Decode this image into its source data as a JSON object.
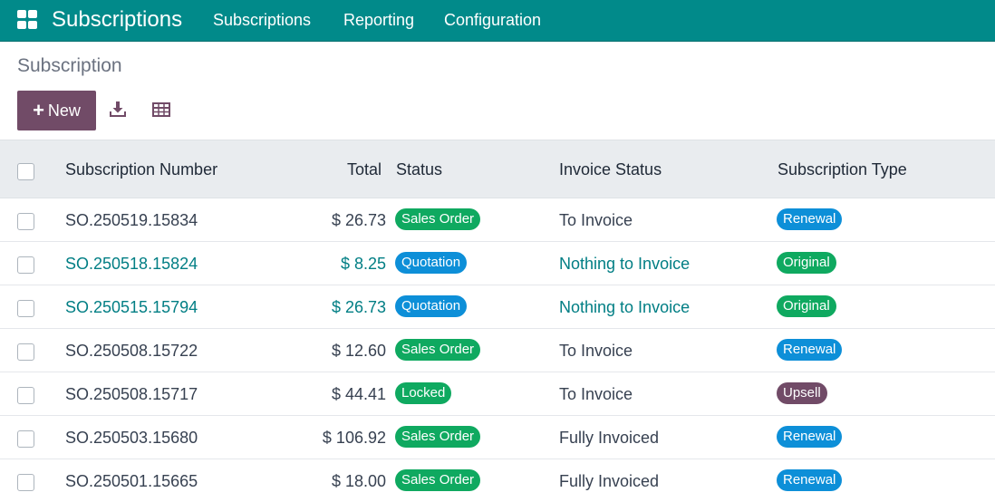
{
  "navbar": {
    "app_title": "Subscriptions",
    "menus": [
      "Subscriptions",
      "Reporting",
      "Configuration"
    ],
    "icon": "apps-grid-icon"
  },
  "control_panel": {
    "breadcrumb": "Subscription",
    "new_label": "New",
    "new_icon": "plus-icon",
    "download_icon": "download-icon",
    "spreadsheet_icon": "spreadsheet-icon"
  },
  "table": {
    "columns": {
      "number": "Subscription Number",
      "total": "Total",
      "status": "Status",
      "invoice_status": "Invoice Status",
      "type": "Subscription Type"
    },
    "rows": [
      {
        "number": "SO.250519.15834",
        "total": "$ 26.73",
        "status": "Sales Order",
        "invoice_status": "To Invoice",
        "type": "Renewal",
        "highlight": false
      },
      {
        "number": "SO.250518.15824",
        "total": "$ 8.25",
        "status": "Quotation",
        "invoice_status": "Nothing to Invoice",
        "type": "Original",
        "highlight": true
      },
      {
        "number": "SO.250515.15794",
        "total": "$ 26.73",
        "status": "Quotation",
        "invoice_status": "Nothing to Invoice",
        "type": "Original",
        "highlight": true
      },
      {
        "number": "SO.250508.15722",
        "total": "$ 12.60",
        "status": "Sales Order",
        "invoice_status": "To Invoice",
        "type": "Renewal",
        "highlight": false
      },
      {
        "number": "SO.250508.15717",
        "total": "$ 44.41",
        "status": "Locked",
        "invoice_status": "To Invoice",
        "type": "Upsell",
        "highlight": false
      },
      {
        "number": "SO.250503.15680",
        "total": "$ 106.92",
        "status": "Sales Order",
        "invoice_status": "Fully Invoiced",
        "type": "Renewal",
        "highlight": false
      },
      {
        "number": "SO.250501.15665",
        "total": "$ 18.00",
        "status": "Sales Order",
        "invoice_status": "Fully Invoiced",
        "type": "Renewal",
        "highlight": false
      }
    ]
  },
  "colors": {
    "navbar": "#018a8a",
    "primary_button": "#714b67",
    "link": "#017e84",
    "badge_green": "#0fa960",
    "badge_blue": "#0d8fd8",
    "badge_purple": "#714b67"
  }
}
